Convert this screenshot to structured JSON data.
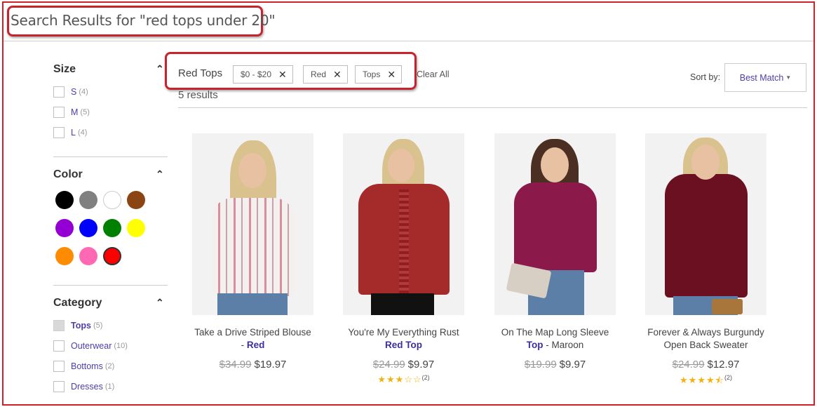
{
  "search": {
    "title": "Search Results for \"red tops under 20\""
  },
  "sidebar": {
    "size": {
      "title": "Size",
      "options": [
        {
          "label": "S",
          "count": "(4)"
        },
        {
          "label": "M",
          "count": "(5)"
        },
        {
          "label": "L",
          "count": "(4)"
        }
      ]
    },
    "color": {
      "title": "Color",
      "swatches": [
        "#000000",
        "#808080",
        "#ffffff",
        "#8b4513",
        "#9400d3",
        "#0000ff",
        "#008000",
        "#ffff00",
        "#ff8c00",
        "#ff69b4",
        "#ff0000"
      ],
      "selected": "#ff0000"
    },
    "category": {
      "title": "Category",
      "options": [
        {
          "label": "Tops",
          "count": "(5)",
          "checked": true
        },
        {
          "label": "Outerwear",
          "count": "(10)"
        },
        {
          "label": "Bottoms",
          "count": "(2)"
        },
        {
          "label": "Dresses",
          "count": "(1)"
        }
      ]
    }
  },
  "filters": {
    "label": "Red Tops",
    "chips": [
      "$0 - $20",
      "Red",
      "Tops"
    ],
    "clear_all": "Clear All",
    "results": "5 results"
  },
  "sort": {
    "label": "Sort by:",
    "value": "Best Match"
  },
  "products": [
    {
      "title_a": "Take a Drive Striped Blouse",
      "title_sep": "- ",
      "title_hl": "Red",
      "title_b": "",
      "old_price": "$34.99",
      "price": "$19.97",
      "stars": "",
      "rating_count": ""
    },
    {
      "title_a": "You're My Everything Rust",
      "title_sep": "",
      "title_hl": "Red Top",
      "title_b": "",
      "old_price": "$24.99",
      "price": "$9.97",
      "stars": "★★★☆☆",
      "rating_count": "(2)"
    },
    {
      "title_a": "On The Map Long Sleeve",
      "title_sep": "",
      "title_hl": "Top",
      "title_b": " - Maroon",
      "old_price": "$19.99",
      "price": "$9.97",
      "stars": "",
      "rating_count": ""
    },
    {
      "title_a": "Forever & Always Burgundy",
      "title_sep": "",
      "title_hl": "",
      "title_b": "Open Back Sweater",
      "old_price": "$24.99",
      "price": "$12.97",
      "stars": "★★★★⯪",
      "rating_count": "(2)"
    }
  ]
}
